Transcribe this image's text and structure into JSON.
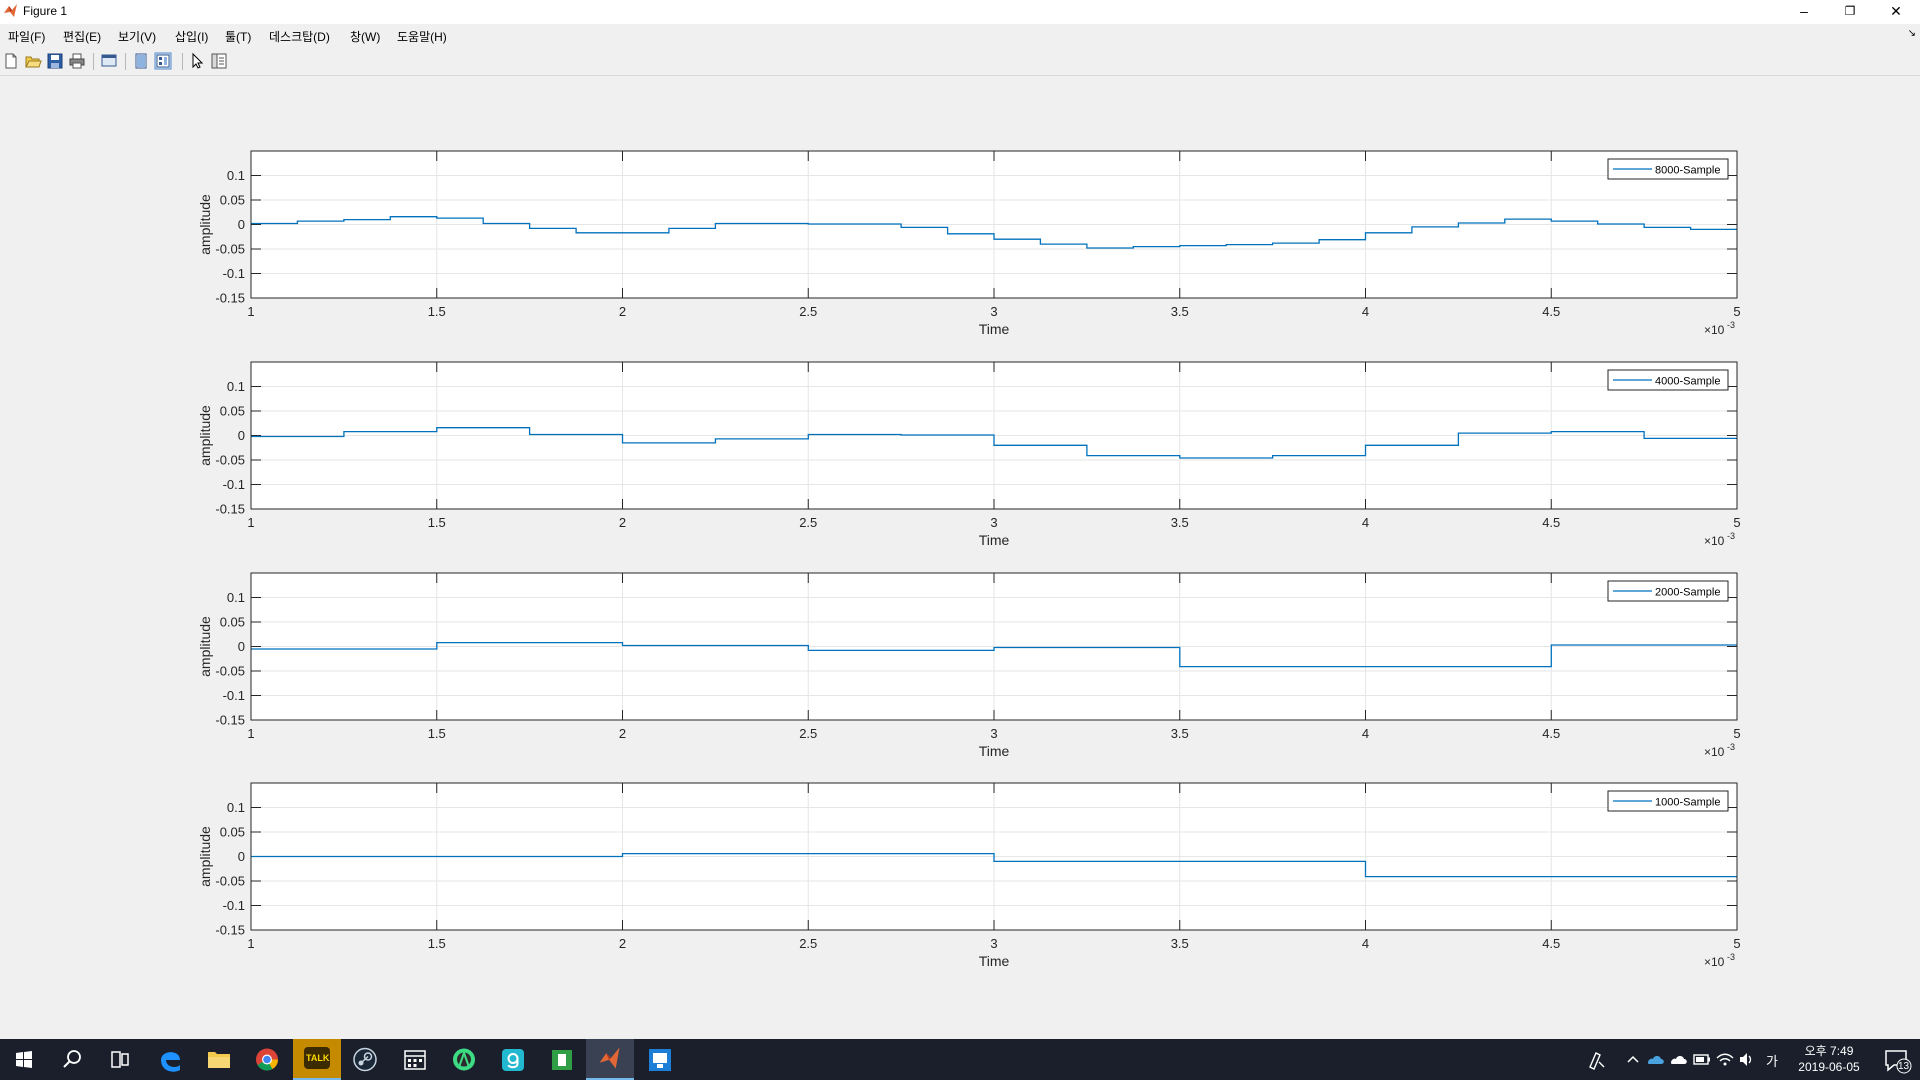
{
  "window": {
    "title": "Figure 1",
    "minimize_glyph": "–",
    "restore_glyph": "❐",
    "close_glyph": "✕"
  },
  "menu": {
    "items": [
      "파일(F)",
      "편집(E)",
      "보기(V)",
      "삽입(I)",
      "툴(T)",
      "데스크탑(D)",
      "창(W)",
      "도움말(H)"
    ],
    "dock_arrow": "↘"
  },
  "toolbar": {
    "icons": [
      "new-figure-icon",
      "open-file-icon",
      "save-icon",
      "print-icon",
      "print-preview-icon",
      "hide-plot-tools-icon",
      "show-plot-tools-icon",
      "edit-plot-icon",
      "property-inspector-icon"
    ]
  },
  "chart_data": [
    {
      "type": "line",
      "step": true,
      "xlabel": "Time",
      "ylabel": "amplitude",
      "x_scale_label": "×10",
      "x_scale_exp": "-3",
      "xlim": [
        1,
        5
      ],
      "ylim": [
        -0.15,
        0.15
      ],
      "xticks": [
        "1",
        "1.5",
        "2",
        "2.5",
        "3",
        "3.5",
        "4",
        "4.5",
        "5"
      ],
      "yticks": [
        "0.1",
        "0.05",
        "0",
        "-0.05",
        "-0.1",
        "-0.15"
      ],
      "grid": true,
      "legend_position": "top-right",
      "series": [
        {
          "name": "8000-Sample",
          "color": "#0072bd",
          "x": [
            1.0,
            1.125,
            1.25,
            1.375,
            1.5,
            1.625,
            1.75,
            1.875,
            2.0,
            2.125,
            2.25,
            2.375,
            2.5,
            2.625,
            2.75,
            2.875,
            3.0,
            3.125,
            3.25,
            3.375,
            3.5,
            3.625,
            3.75,
            3.875,
            4.0,
            4.125,
            4.25,
            4.375,
            4.5,
            4.625,
            4.75,
            4.875
          ],
          "y": [
            0.002,
            0.007,
            0.01,
            0.016,
            0.013,
            0.002,
            -0.008,
            -0.017,
            -0.017,
            -0.008,
            0.002,
            0.002,
            0.001,
            0.001,
            -0.006,
            -0.019,
            -0.03,
            -0.04,
            -0.048,
            -0.045,
            -0.043,
            -0.041,
            -0.038,
            -0.031,
            -0.017,
            -0.005,
            0.003,
            0.011,
            0.007,
            0.001,
            -0.006,
            -0.01
          ]
        }
      ]
    },
    {
      "type": "line",
      "step": true,
      "xlabel": "Time",
      "ylabel": "amplitude",
      "x_scale_label": "×10",
      "x_scale_exp": "-3",
      "xlim": [
        1,
        5
      ],
      "ylim": [
        -0.15,
        0.15
      ],
      "xticks": [
        "1",
        "1.5",
        "2",
        "2.5",
        "3",
        "3.5",
        "4",
        "4.5",
        "5"
      ],
      "yticks": [
        "0.1",
        "0.05",
        "0",
        "-0.05",
        "-0.1",
        "-0.15"
      ],
      "grid": true,
      "legend_position": "top-right",
      "series": [
        {
          "name": "4000-Sample",
          "color": "#0072bd",
          "x": [
            1.0,
            1.25,
            1.5,
            1.75,
            2.0,
            2.25,
            2.5,
            2.75,
            3.0,
            3.25,
            3.5,
            3.75,
            4.0,
            4.25,
            4.5,
            4.75
          ],
          "y": [
            -0.002,
            0.008,
            0.016,
            0.002,
            -0.015,
            -0.007,
            0.002,
            0.001,
            -0.02,
            -0.041,
            -0.046,
            -0.041,
            -0.02,
            0.005,
            0.008,
            -0.006
          ]
        }
      ]
    },
    {
      "type": "line",
      "step": true,
      "xlabel": "Time",
      "ylabel": "amplitude",
      "x_scale_label": "×10",
      "x_scale_exp": "-3",
      "xlim": [
        1,
        5
      ],
      "ylim": [
        -0.15,
        0.15
      ],
      "xticks": [
        "1",
        "1.5",
        "2",
        "2.5",
        "3",
        "3.5",
        "4",
        "4.5",
        "5"
      ],
      "yticks": [
        "0.1",
        "0.05",
        "0",
        "-0.05",
        "-0.1",
        "-0.15"
      ],
      "grid": true,
      "legend_position": "top-right",
      "series": [
        {
          "name": "2000-Sample",
          "color": "#0072bd",
          "x": [
            1.0,
            1.5,
            2.0,
            2.5,
            3.0,
            3.5,
            4.0,
            4.5
          ],
          "y": [
            -0.005,
            0.008,
            0.002,
            -0.008,
            -0.002,
            -0.041,
            -0.041,
            0.003
          ]
        }
      ]
    },
    {
      "type": "line",
      "step": true,
      "xlabel": "Time",
      "ylabel": "amplitude",
      "x_scale_label": "×10",
      "x_scale_exp": "-3",
      "xlim": [
        1,
        5
      ],
      "ylim": [
        -0.15,
        0.15
      ],
      "xticks": [
        "1",
        "1.5",
        "2",
        "2.5",
        "3",
        "3.5",
        "4",
        "4.5",
        "5"
      ],
      "yticks": [
        "0.1",
        "0.05",
        "0",
        "-0.05",
        "-0.1",
        "-0.15"
      ],
      "grid": true,
      "legend_position": "top-right",
      "series": [
        {
          "name": "1000-Sample",
          "color": "#0072bd",
          "x": [
            1.0,
            2.0,
            3.0,
            4.0
          ],
          "y": [
            0.0,
            0.006,
            -0.01,
            -0.041
          ]
        }
      ]
    }
  ],
  "taskbar": {
    "apps": [
      "windows-start-icon",
      "search-icon",
      "task-view-icon",
      "edge-browser-icon",
      "file-explorer-icon",
      "chrome-icon",
      "kakaotalk-icon",
      "steam-icon",
      "calendar-icon",
      "android-studio-icon",
      "g-app-icon",
      "green-app-icon",
      "matlab-icon",
      "remote-app-icon"
    ],
    "kakao_label": "TALK",
    "ime_label": "가",
    "time": "오후 7:49",
    "date": "2019-06-05",
    "notification_count": "13"
  }
}
